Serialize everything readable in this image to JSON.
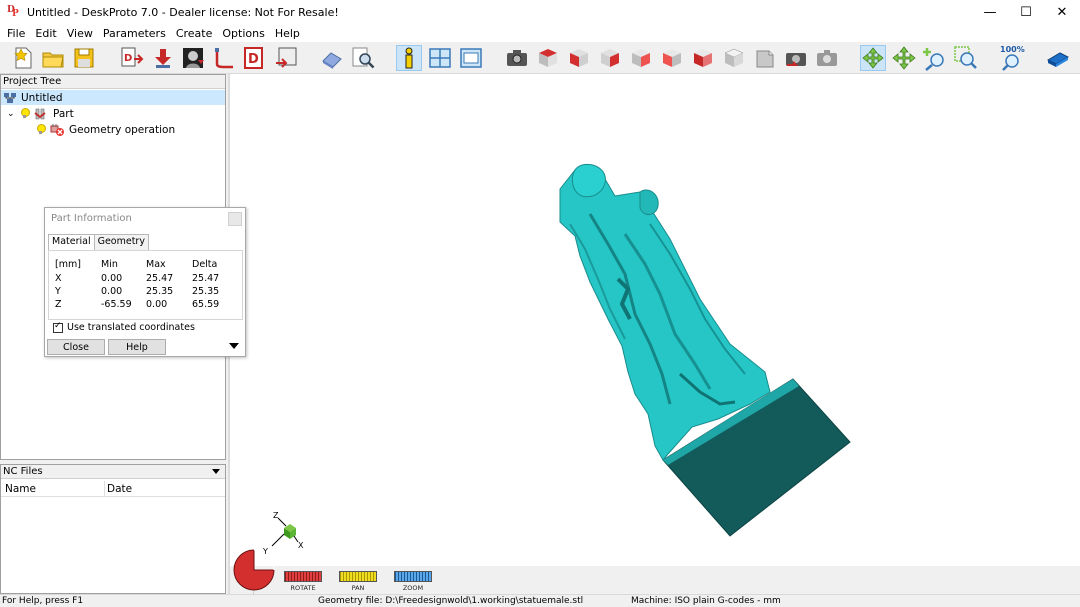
{
  "window": {
    "title": "Untitled - DeskProto 7.0 - Dealer license: Not For Resale!",
    "minimize": "—",
    "maximize": "☐",
    "close": "✕"
  },
  "menu": [
    "File",
    "Edit",
    "View",
    "Parameters",
    "Create",
    "Options",
    "Help"
  ],
  "toolbar": {
    "zoom_level": "100%"
  },
  "project_tree": {
    "header": "Project Tree",
    "items": [
      {
        "label": "Untitled"
      },
      {
        "label": "Part"
      },
      {
        "label": "Geometry operation"
      }
    ]
  },
  "nc_files": {
    "header": "NC Files",
    "columns": [
      "Name",
      "Date"
    ]
  },
  "part_information": {
    "title": "Part Information",
    "tabs": [
      "Material",
      "Geometry"
    ],
    "headers": [
      "[mm]",
      "Min",
      "Max",
      "Delta"
    ],
    "rows": [
      [
        "X",
        "0.00",
        "25.47",
        "25.47"
      ],
      [
        "Y",
        "0.00",
        "25.35",
        "25.35"
      ],
      [
        "Z",
        "-65.59",
        "0.00",
        "65.59"
      ]
    ],
    "checkbox_label": "Use translated coordinates",
    "close_label": "Close",
    "help_label": "Help"
  },
  "view_controls": {
    "rotate": "ROTATE",
    "pan": "PAN",
    "zoom": "ZOOM",
    "axes": {
      "z": "Z",
      "x": "X",
      "y": "Y"
    }
  },
  "status": {
    "help": "For Help, press F1",
    "geometry": "Geometry file: D:\\Freedesignwold\\1.working\\statuemale.stl",
    "machine": "Machine: ISO plain G-codes - mm"
  },
  "colors": {
    "model": "#26c6c6",
    "model_shadow": "#1a7e80",
    "base_dark": "#135a5a",
    "selection": "#cce8ff",
    "active_tool": "#cce4f7"
  }
}
